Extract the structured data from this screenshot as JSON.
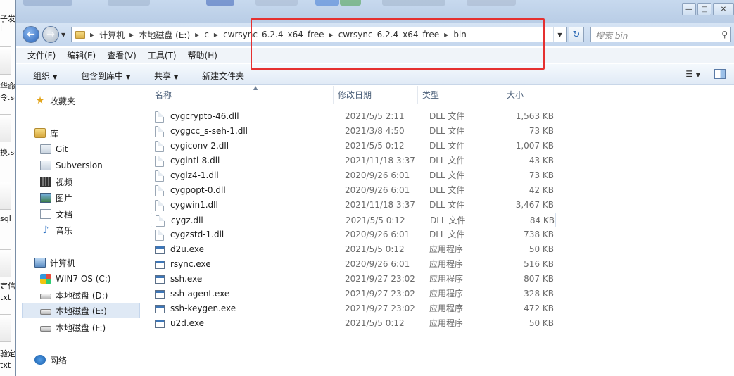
{
  "desktop": {
    "fragments": [
      "子发送",
      "l",
      "华命令",
      "令.sc",
      "换.sc",
      "sql",
      "定信息",
      "txt",
      "验定时",
      "txt"
    ]
  },
  "window": {
    "controls": {
      "minimize": "—",
      "maximize": "□",
      "close": "✕"
    }
  },
  "address": {
    "breadcrumbs": [
      "计算机",
      "本地磁盘 (E:)",
      "c",
      "cwrsync_6.2.4_x64_free",
      "cwrsync_6.2.4_x64_free",
      "bin"
    ],
    "search_placeholder": "搜索 bin"
  },
  "menu": [
    "文件(F)",
    "编辑(E)",
    "查看(V)",
    "工具(T)",
    "帮助(H)"
  ],
  "toolbar": {
    "organize": "组织",
    "include_in_library": "包含到库中",
    "share": "共享",
    "new_folder": "新建文件夹"
  },
  "nav": {
    "favorites": "收藏夹",
    "libraries": "库",
    "lib_items": [
      "Git",
      "Subversion",
      "视频",
      "图片",
      "文档",
      "音乐"
    ],
    "computer": "计算机",
    "drives": [
      "WIN7 OS (C:)",
      "本地磁盘 (D:)",
      "本地磁盘 (E:)",
      "本地磁盘 (F:)"
    ],
    "selected_drive": "本地磁盘 (E:)",
    "network": "网络"
  },
  "columns": {
    "name": "名称",
    "modified": "修改日期",
    "type": "类型",
    "size": "大小"
  },
  "files": [
    {
      "name": "cygcrypto-46.dll",
      "modified": "2021/5/5 2:11",
      "type": "DLL 文件",
      "size": "1,563 KB",
      "icon": "dll-icon"
    },
    {
      "name": "cyggcc_s-seh-1.dll",
      "modified": "2021/3/8 4:50",
      "type": "DLL 文件",
      "size": "73 KB",
      "icon": "dll-icon"
    },
    {
      "name": "cygiconv-2.dll",
      "modified": "2021/5/5 0:12",
      "type": "DLL 文件",
      "size": "1,007 KB",
      "icon": "dll-icon"
    },
    {
      "name": "cygintl-8.dll",
      "modified": "2021/11/18 3:37",
      "type": "DLL 文件",
      "size": "43 KB",
      "icon": "dll-icon"
    },
    {
      "name": "cyglz4-1.dll",
      "modified": "2020/9/26 6:01",
      "type": "DLL 文件",
      "size": "73 KB",
      "icon": "dll-icon"
    },
    {
      "name": "cygpopt-0.dll",
      "modified": "2020/9/26 6:01",
      "type": "DLL 文件",
      "size": "42 KB",
      "icon": "dll-icon"
    },
    {
      "name": "cygwin1.dll",
      "modified": "2021/11/18 3:37",
      "type": "DLL 文件",
      "size": "3,467 KB",
      "icon": "dll-icon"
    },
    {
      "name": "cygz.dll",
      "modified": "2021/5/5 0:12",
      "type": "DLL 文件",
      "size": "84 KB",
      "icon": "dll-icon"
    },
    {
      "name": "cygzstd-1.dll",
      "modified": "2020/9/26 6:01",
      "type": "DLL 文件",
      "size": "738 KB",
      "icon": "dll-icon"
    },
    {
      "name": "d2u.exe",
      "modified": "2021/5/5 0:12",
      "type": "应用程序",
      "size": "50 KB",
      "icon": "exe-icon"
    },
    {
      "name": "rsync.exe",
      "modified": "2020/9/26 6:01",
      "type": "应用程序",
      "size": "516 KB",
      "icon": "exe-icon"
    },
    {
      "name": "ssh.exe",
      "modified": "2021/9/27 23:02",
      "type": "应用程序",
      "size": "807 KB",
      "icon": "exe-icon"
    },
    {
      "name": "ssh-agent.exe",
      "modified": "2021/9/27 23:02",
      "type": "应用程序",
      "size": "328 KB",
      "icon": "exe-icon"
    },
    {
      "name": "ssh-keygen.exe",
      "modified": "2021/9/27 23:02",
      "type": "应用程序",
      "size": "472 KB",
      "icon": "exe-icon"
    },
    {
      "name": "u2d.exe",
      "modified": "2021/5/5 0:12",
      "type": "应用程序",
      "size": "50 KB",
      "icon": "exe-icon"
    }
  ],
  "highlighted_file": "cygz.dll",
  "annotation_color": "#e53030"
}
